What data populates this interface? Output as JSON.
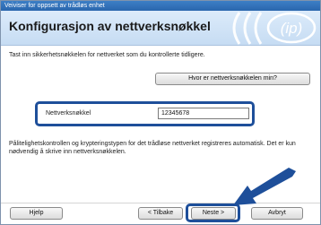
{
  "window": {
    "title": "Veiviser for oppsett av trådløs enhet"
  },
  "header": {
    "title": "Konfigurasjon av nettverksnøkkel"
  },
  "instruction": "Tast inn sikkerhetsnøkkelen for nettverket som du kontrollerte tidligere.",
  "help_key_button": "Hvor er nettverksnøkkelen min?",
  "network_key": {
    "label": "Nettverksnøkkel",
    "value": "12345678"
  },
  "info_text": "Pålitelighetskontrollen og krypteringstypen for det trådløse nettverket registreres automatisk. Det er kun nødvendig å skrive inn nettverksnøkkelen.",
  "buttons": {
    "help": "Hjelp",
    "back": "< Tilbake",
    "next": "Neste >",
    "cancel": "Avbryt"
  },
  "colors": {
    "accent": "#1e4f9a",
    "header_bg": "#c6dcf3",
    "titlebar": "#2a66ad"
  },
  "icons": [
    "wifi-logo-icon",
    "arrow-pointer-icon"
  ]
}
